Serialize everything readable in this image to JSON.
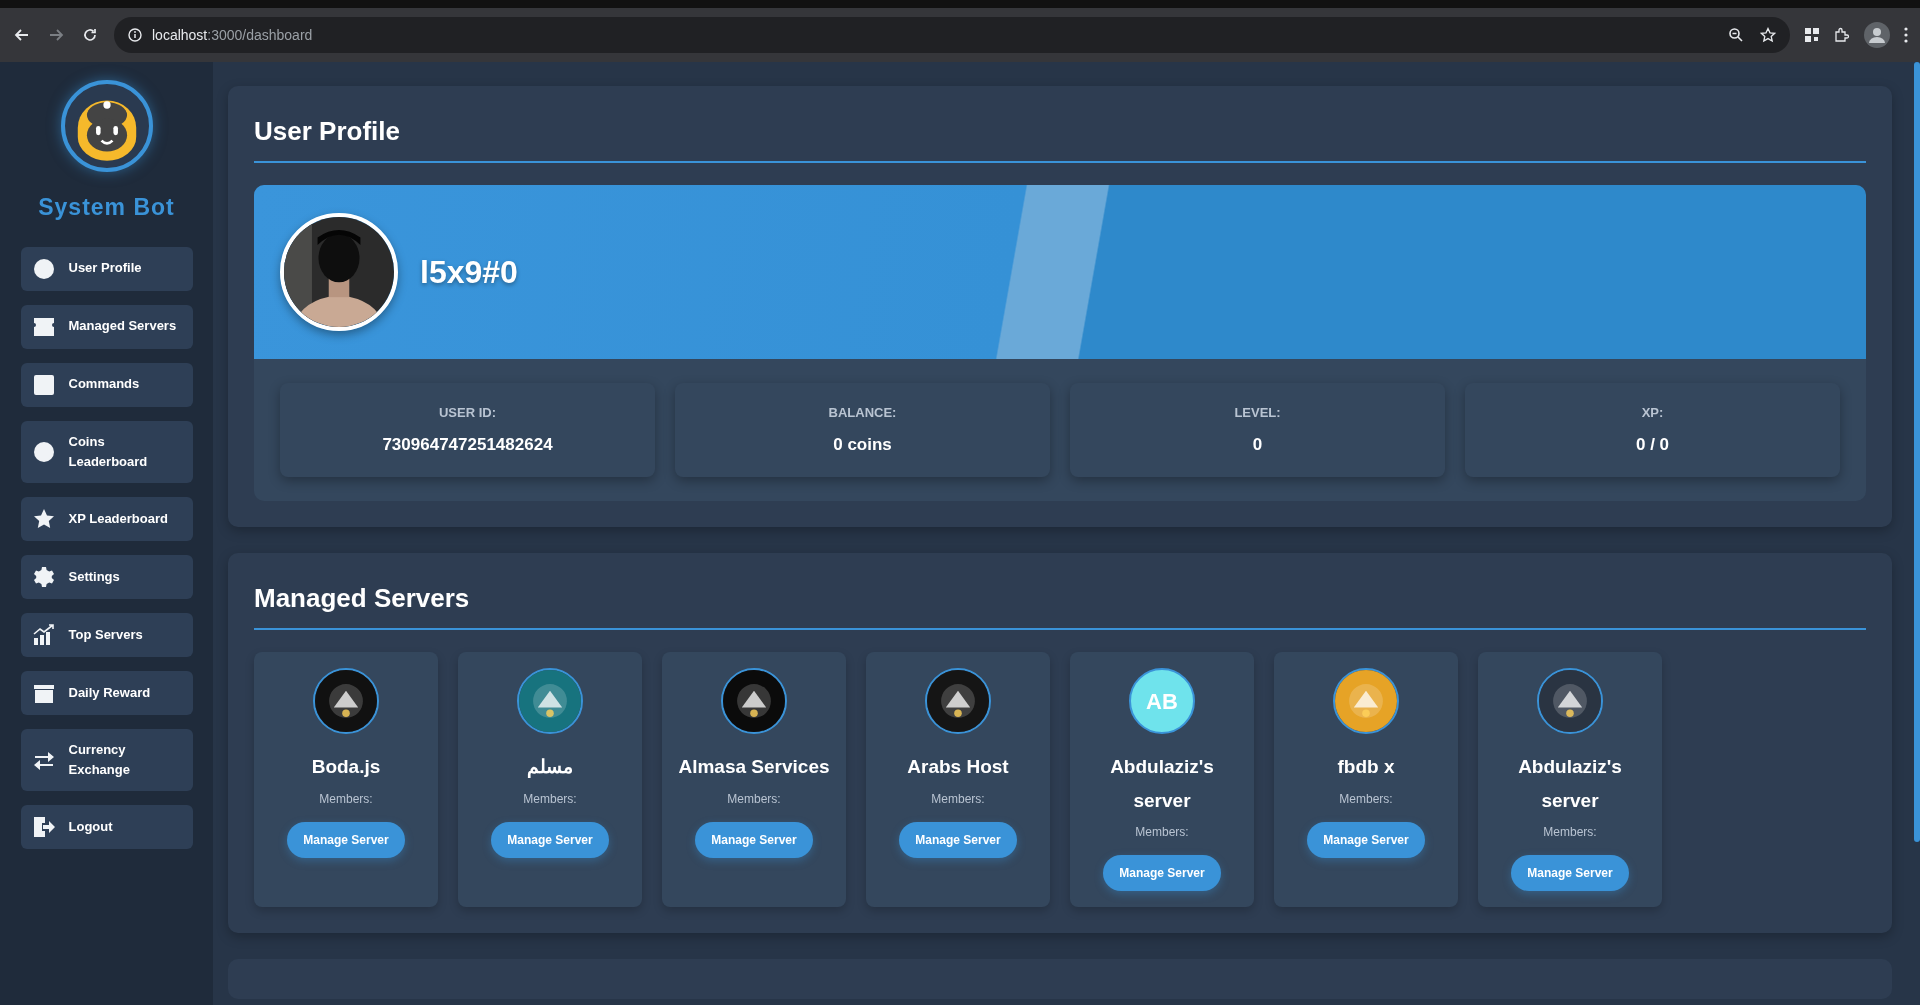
{
  "browser": {
    "url_host": "localhost",
    "url_path": ":3000/dashboard"
  },
  "sidebar": {
    "brand": "System Bot",
    "items": [
      {
        "label": "User Profile",
        "kind": "circle"
      },
      {
        "label": "Managed Servers",
        "kind": "ticket"
      },
      {
        "label": "Commands",
        "kind": "square"
      },
      {
        "label": "Coins Leaderboard",
        "kind": "circle"
      },
      {
        "label": "XP Leaderboard",
        "kind": "star"
      },
      {
        "label": "Settings",
        "kind": "gear"
      },
      {
        "label": "Top Servers",
        "kind": "chart"
      },
      {
        "label": "Daily Reward",
        "kind": "gift"
      },
      {
        "label": "Currency Exchange",
        "kind": "exchange"
      },
      {
        "label": "Logout",
        "kind": "logout"
      }
    ]
  },
  "profile": {
    "title": "User Profile",
    "username": "l5x9#0",
    "stats": [
      {
        "label": "USER ID:",
        "value": "730964747251482624"
      },
      {
        "label": "BALANCE:",
        "value": "0 coins"
      },
      {
        "label": "LEVEL:",
        "value": "0"
      },
      {
        "label": "XP:",
        "value": "0 / 0"
      }
    ]
  },
  "servers": {
    "title": "Managed Servers",
    "items": [
      {
        "name": "Boda.js",
        "members": "Members:",
        "button": "Manage Server",
        "kind": "picture"
      },
      {
        "name": "مسلم",
        "members": "Members:",
        "button": "Manage Server",
        "kind": "picture"
      },
      {
        "name": "Almasa Services",
        "members": "Members:",
        "button": "Manage Server",
        "kind": "picture"
      },
      {
        "name": "Arabs Host",
        "members": "Members:",
        "button": "Manage Server",
        "kind": "picture"
      },
      {
        "name": "Abdulaziz's server",
        "members": "Members:",
        "button": "Manage Server",
        "kind": "initials",
        "initials": "AB"
      },
      {
        "name": "fbdb x",
        "members": "Members:",
        "button": "Manage Server",
        "kind": "picture"
      },
      {
        "name": "Abdulaziz's server",
        "members": "Members:",
        "button": "Manage Server",
        "kind": "picture"
      }
    ]
  }
}
